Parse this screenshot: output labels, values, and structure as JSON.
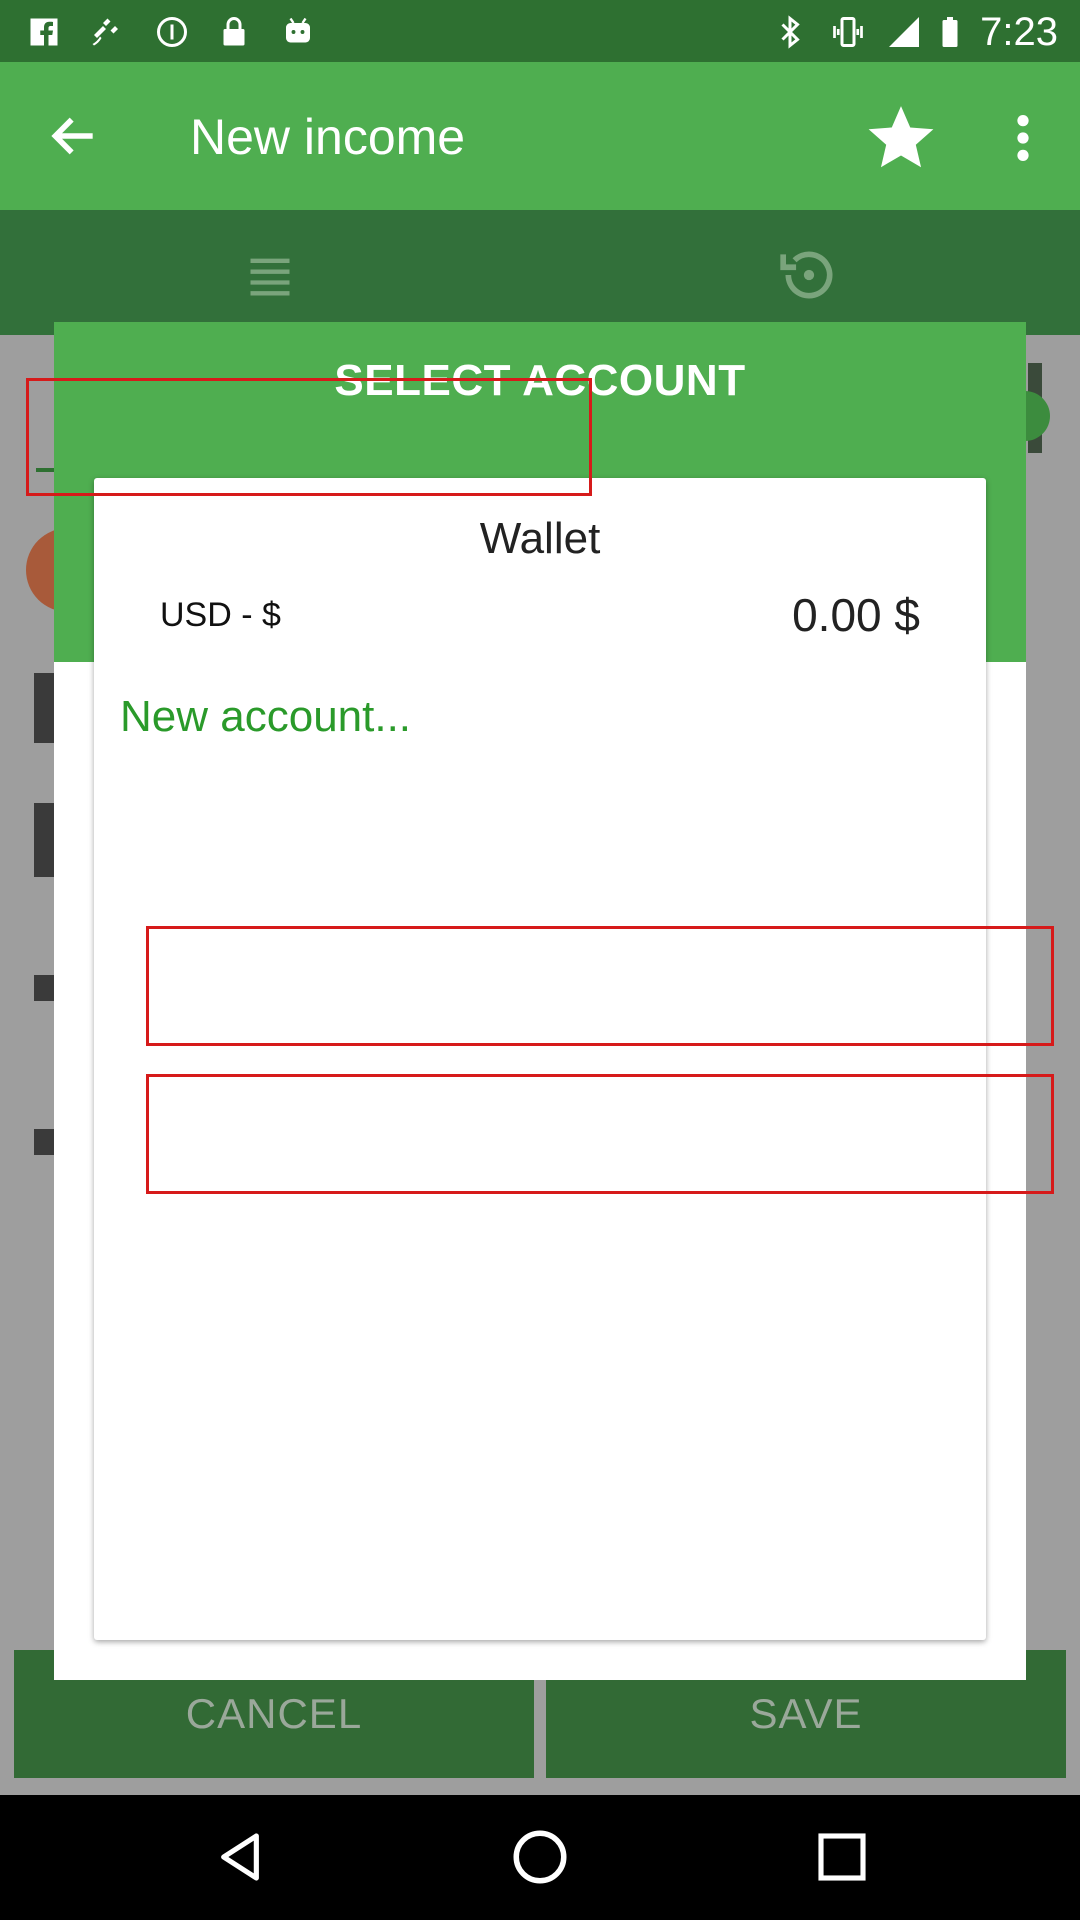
{
  "status_bar": {
    "time": "7:23",
    "icons": [
      "facebook-icon",
      "fake-gps-icon",
      "info-icon",
      "lock-icon",
      "android-icon",
      "bluetooth-icon",
      "vibrate-icon",
      "signal-icon",
      "battery-icon"
    ]
  },
  "app_bar": {
    "title": "New income",
    "back_icon": "arrow-back-icon",
    "favorite_icon": "star-icon",
    "menu_icon": "more-vert-icon"
  },
  "tabs": [
    {
      "icon": "list-icon"
    },
    {
      "icon": "history-icon"
    }
  ],
  "dialog": {
    "title": "SELECT ACCOUNT",
    "accounts": [
      {
        "name": "Wallet",
        "currency": "USD - $",
        "balance": "0.00 $"
      }
    ],
    "new_account_label": "New account..."
  },
  "bottom_buttons": {
    "cancel": "CANCEL",
    "save": "SAVE"
  },
  "colors": {
    "primary": "#4fae50",
    "primary_dark": "#2e7031",
    "accent_text": "#2a9a2a",
    "highlight_box": "#d61a1a"
  }
}
